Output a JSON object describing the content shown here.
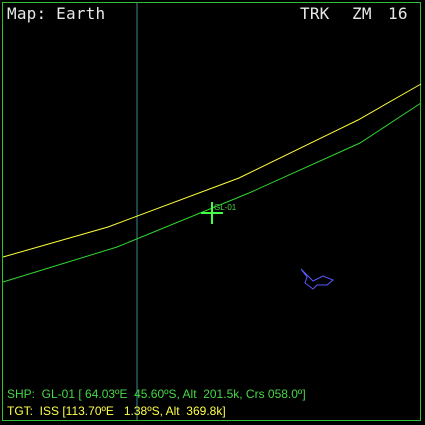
{
  "header": {
    "map_title": "Map: Earth",
    "mode": "TRK",
    "zoom_label": "ZM",
    "zoom_value": "16"
  },
  "map": {
    "ship_marker_label": "GL-01"
  },
  "hud": {
    "ship_line": "SHP:  GL-01 [ 64.03ºE  45.60ºS, Alt  201.5k, Crs 058.0º]",
    "target_line": "TGT:  ISS [113.70ºE   1.38ºS, Alt  369.8k]"
  },
  "colors": {
    "frame": "#2fbf2f",
    "ship_track": "#2fd62f",
    "target_track": "#ffff3a",
    "crosshair": "#44ff44",
    "target_glyph": "#5a5aff",
    "meridian": "#3a8a8a"
  },
  "icons": {
    "ship": "crosshair-icon",
    "target": "spacecraft-icon"
  }
}
